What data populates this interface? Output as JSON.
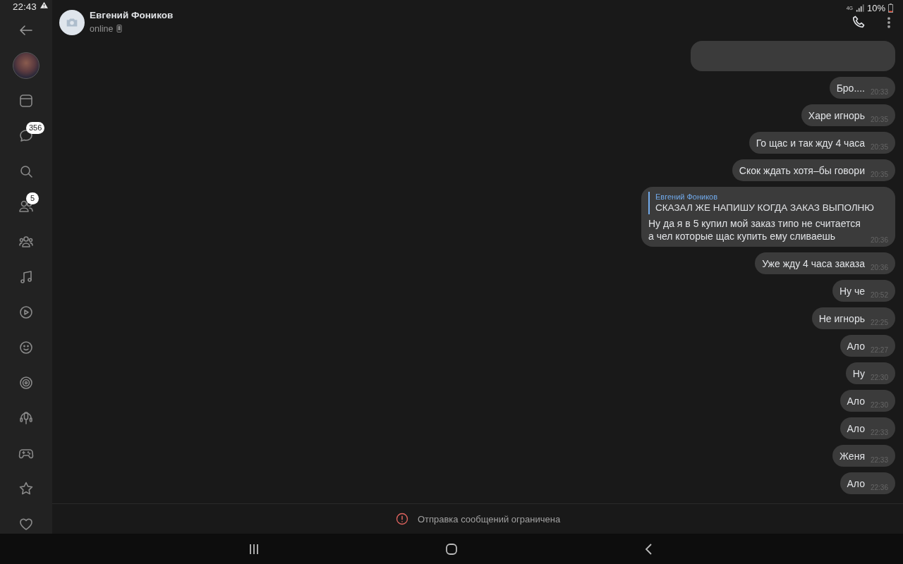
{
  "status_bar": {
    "time": "22:43",
    "network": "4G",
    "battery": "10%"
  },
  "sidebar": {
    "items": [
      {
        "kind": "news"
      },
      {
        "kind": "messages",
        "badge": "356"
      },
      {
        "kind": "search"
      },
      {
        "kind": "friends",
        "badge": "5"
      },
      {
        "kind": "communities"
      },
      {
        "kind": "music"
      },
      {
        "kind": "video"
      },
      {
        "kind": "stickers"
      },
      {
        "kind": "target"
      },
      {
        "kind": "podcasts"
      },
      {
        "kind": "games"
      },
      {
        "kind": "favorites"
      },
      {
        "kind": "heart"
      }
    ]
  },
  "header": {
    "name": "Евгений Фоников",
    "status": "online"
  },
  "messages": [
    {
      "kind": "clipped"
    },
    {
      "kind": "text",
      "text": "Бро....",
      "time": "20:33"
    },
    {
      "kind": "text",
      "text": "Харе игнорь",
      "time": "20:35"
    },
    {
      "kind": "text",
      "text": "Го щас и так жду 4 часа",
      "time": "20:35"
    },
    {
      "kind": "text",
      "text": "Скок ждать хотя–бы говори",
      "time": "20:35"
    },
    {
      "kind": "reply",
      "reply_author": "Евгений Фоников",
      "reply_text": "СКАЗАЛ ЖЕ НАПИШУ КОГДА ЗАКАЗ ВЫПОЛНЮ",
      "text": "Ну да я в 5 купил мой заказ типо не считается а чел которые щас купить ему сливаешь",
      "time": "20:36"
    },
    {
      "kind": "text",
      "text": "Уже жду 4 часа заказа",
      "time": "20:36"
    },
    {
      "kind": "text",
      "text": "Ну че",
      "time": "20:52"
    },
    {
      "kind": "text",
      "text": "Не игнорь",
      "time": "22:25"
    },
    {
      "kind": "text",
      "text": "Ало",
      "time": "22:27"
    },
    {
      "kind": "text",
      "text": "Ну",
      "time": "22:30"
    },
    {
      "kind": "text",
      "text": "Ало",
      "time": "22:30"
    },
    {
      "kind": "text",
      "text": "Ало",
      "time": "22:33"
    },
    {
      "kind": "text",
      "text": "Женя",
      "time": "22:33"
    },
    {
      "kind": "text",
      "text": "Ало",
      "time": "22:36"
    }
  ],
  "notice": "Отправка сообщений ограничена"
}
